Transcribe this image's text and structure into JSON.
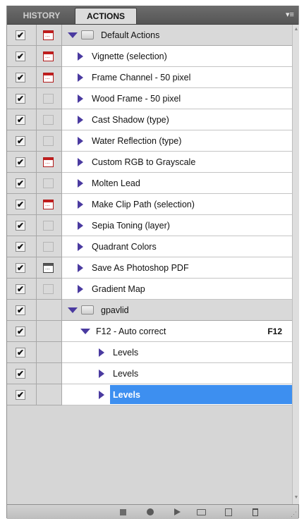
{
  "tabs": {
    "history": "HISTORY",
    "actions": "ACTIONS"
  },
  "panel_menu_icon": "panel-menu-icon",
  "sets": [
    {
      "name": "Default Actions"
    },
    {
      "name": "gpavlid"
    }
  ],
  "actions": [
    {
      "name": "Vignette (selection)",
      "dialog": "red"
    },
    {
      "name": "Frame Channel - 50 pixel",
      "dialog": "red"
    },
    {
      "name": "Wood Frame - 50 pixel",
      "dialog": "empty"
    },
    {
      "name": "Cast Shadow (type)",
      "dialog": "empty"
    },
    {
      "name": "Water Reflection (type)",
      "dialog": "empty"
    },
    {
      "name": "Custom RGB to Grayscale",
      "dialog": "red"
    },
    {
      "name": "Molten Lead",
      "dialog": "empty"
    },
    {
      "name": "Make Clip Path (selection)",
      "dialog": "red"
    },
    {
      "name": "Sepia Toning (layer)",
      "dialog": "empty"
    },
    {
      "name": "Quadrant Colors",
      "dialog": "empty"
    },
    {
      "name": "Save As Photoshop PDF",
      "dialog": "dark"
    },
    {
      "name": "Gradient Map",
      "dialog": "empty"
    }
  ],
  "gpavlid": {
    "action": {
      "name": "F12 - Auto correct",
      "shortcut": "F12"
    },
    "steps": [
      "Levels",
      "Levels",
      "Levels"
    ]
  },
  "check_glyph": "✔",
  "colors": {
    "accent": "#3d8ff0",
    "triangle": "#4a3aa0",
    "dialog_red": "#c21e1e"
  },
  "toolbar": [
    "stop-icon",
    "record-icon",
    "play-icon",
    "new-set-icon",
    "new-action-icon",
    "trash-icon"
  ]
}
